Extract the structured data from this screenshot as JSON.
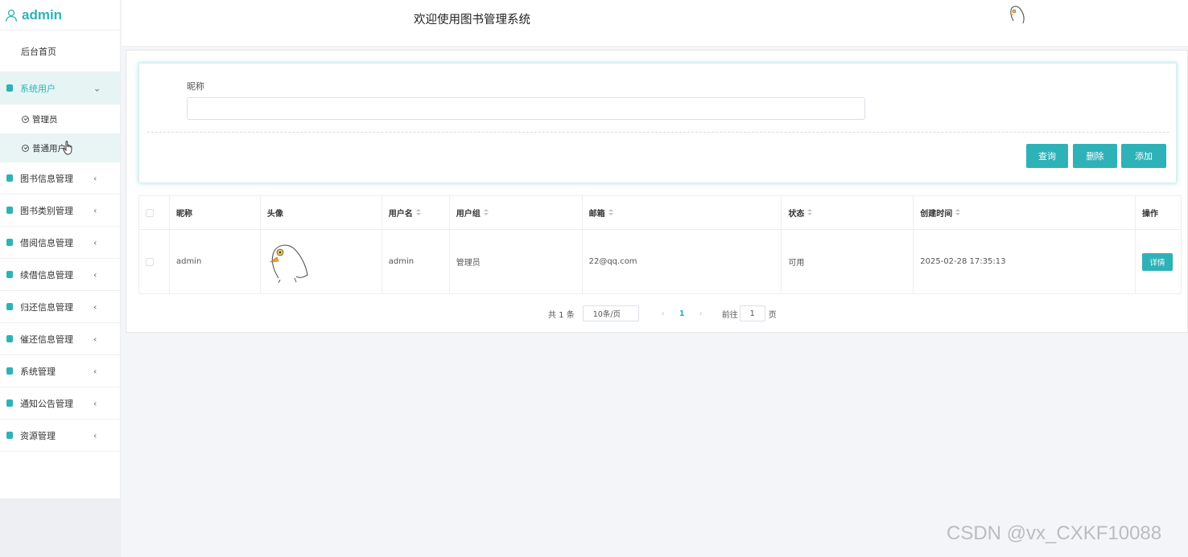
{
  "brand": {
    "name": "admin"
  },
  "header": {
    "title": "欢迎使用图书管理系统"
  },
  "sidebar": {
    "home": "后台首页",
    "items": [
      {
        "label": "系统用户",
        "expanded": true,
        "children": [
          "管理员",
          "普通用户"
        ]
      },
      {
        "label": "图书信息管理"
      },
      {
        "label": "图书类别管理"
      },
      {
        "label": "借阅信息管理"
      },
      {
        "label": "续借信息管理"
      },
      {
        "label": "归还信息管理"
      },
      {
        "label": "催还信息管理"
      },
      {
        "label": "系统管理"
      },
      {
        "label": "通知公告管理"
      },
      {
        "label": "资源管理"
      }
    ]
  },
  "search": {
    "label": "昵称",
    "value": "",
    "buttons": {
      "query": "查询",
      "delete": "删除",
      "add": "添加"
    }
  },
  "table": {
    "columns": [
      "昵称",
      "头像",
      "用户名",
      "用户组",
      "邮箱",
      "状态",
      "创建时间",
      "操作"
    ],
    "rows": [
      {
        "nickname": "admin",
        "username": "admin",
        "group": "管理员",
        "email": "22@qq.com",
        "status": "可用",
        "created": "2025-02-28 17:35:13",
        "action": "详情"
      }
    ]
  },
  "pagination": {
    "total": "共 1 条",
    "page_size": "10条/页",
    "current": "1",
    "goto_label": "前往",
    "goto_value": "1",
    "page_suffix": "页"
  },
  "watermark": "CSDN @vx_CXKF10088",
  "colors": {
    "accent": "#2eb2b8"
  }
}
